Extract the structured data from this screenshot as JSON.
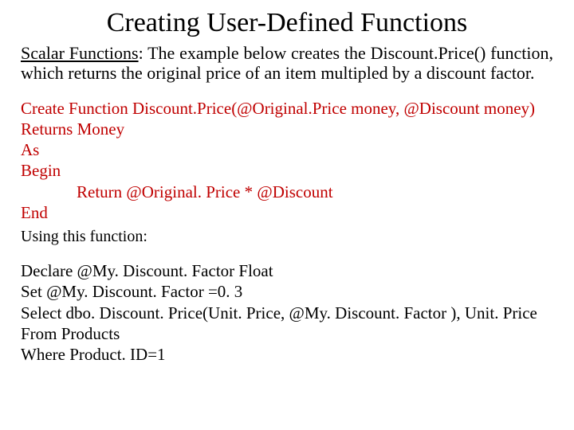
{
  "title": "Creating User-Defined Functions",
  "intro": {
    "lead": "Scalar Functions",
    "rest": ": The example below creates the Discount.Price() function, which returns the original price of an item multipled by a discount factor."
  },
  "code_red": {
    "l1": "Create Function Discount.Price(@Original.Price money, @Discount money)",
    "l2": "Returns Money",
    "l3": "As",
    "l4": "Begin",
    "l5": "Return @Original. Price * @Discount",
    "l6": "End"
  },
  "using_label": "Using this function:",
  "code_black": {
    "l1": "Declare @My. Discount. Factor Float",
    "l2": "Set @My. Discount. Factor =0. 3",
    "l3": "Select dbo. Discount. Price(Unit. Price, @My. Discount. Factor ), Unit. Price",
    "l4": "From Products",
    "l5": "Where Product. ID=1"
  }
}
